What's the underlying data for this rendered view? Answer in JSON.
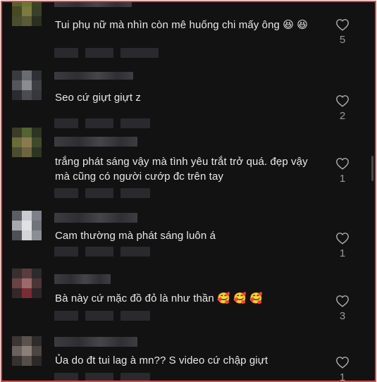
{
  "comments": [
    {
      "text": "Tui phụ nữ mà nhìn còn mê huống chi mấy ông 😆 😆",
      "likes": "5",
      "avatar_colors": [
        "#5b5f2d",
        "#6d7634",
        "#3c4421",
        "#474a24",
        "#7b7a3f",
        "#38402a",
        "#4b4d2f",
        "#5a5a38",
        "#2c3020"
      ]
    },
    {
      "text": "Seo cứ giựt giựt z",
      "likes": "2",
      "avatar_colors": [
        "#3a3b40",
        "#6a6c72",
        "#2f3035",
        "#54565c",
        "#8a8c90",
        "#3d3e43",
        "#2b2c31",
        "#4b4c51",
        "#37383d"
      ]
    },
    {
      "text": "trắng phát sáng vậy mà tình yêu trắt trở quá. đẹp vậy mà cũng có người cướp đc trên tay",
      "likes": "1",
      "avatar_colors": [
        "#3b3d28",
        "#556233",
        "#2e3322",
        "#6a6b3a",
        "#8a7b4f",
        "#3f4a2b",
        "#4a4d2e",
        "#6e6540",
        "#2f3524"
      ]
    },
    {
      "text": "Cam thường mà phát sáng luôn á",
      "likes": "1",
      "avatar_colors": [
        "#5c5e65",
        "#c9cbd0",
        "#7d8087",
        "#a7a9ae",
        "#e0e1e4",
        "#70737a",
        "#4d5057",
        "#d3d4d8",
        "#8b8e94"
      ]
    },
    {
      "text": "Bà này cứ mặc đồ đỏ là như thần 🥰 🥰 🥰",
      "likes": "3",
      "avatar_colors": [
        "#3a2f30",
        "#5a3c3e",
        "#2d2a2c",
        "#6b4144",
        "#9b6a6c",
        "#4a3537",
        "#33292b",
        "#7a2c36",
        "#2c2628"
      ]
    },
    {
      "text": "Ủa do đt tui lag à mn?? S video cứ chập giựt",
      "likes": "1",
      "avatar_colors": [
        "#3a3635",
        "#5b524e",
        "#2f2c2b",
        "#6b605b",
        "#8c7f78",
        "#4d4542",
        "#35312f",
        "#564d49",
        "#2c2928"
      ]
    }
  ]
}
